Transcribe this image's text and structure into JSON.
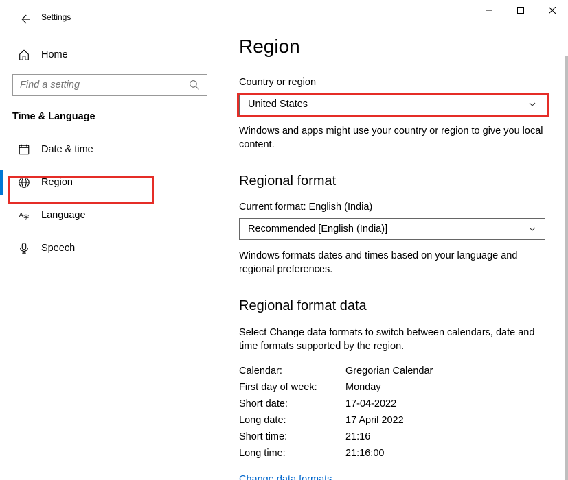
{
  "header": {
    "title": "Settings"
  },
  "sidebar": {
    "home_label": "Home",
    "search_placeholder": "Find a setting",
    "section_title": "Time & Language",
    "items": [
      {
        "label": "Date & time"
      },
      {
        "label": "Region"
      },
      {
        "label": "Language"
      },
      {
        "label": "Speech"
      }
    ]
  },
  "content": {
    "page_title": "Region",
    "country": {
      "label": "Country or region",
      "value": "United States",
      "help": "Windows and apps might use your country or region to give you local content."
    },
    "regional_format": {
      "title": "Regional format",
      "current_label": "Current format: English (India)",
      "value": "Recommended [English (India)]",
      "help": "Windows formats dates and times based on your language and regional preferences."
    },
    "format_data": {
      "title": "Regional format data",
      "help": "Select Change data formats to switch between calendars, date and time formats supported by the region.",
      "rows": [
        {
          "key": "Calendar:",
          "val": "Gregorian Calendar"
        },
        {
          "key": "First day of week:",
          "val": "Monday"
        },
        {
          "key": "Short date:",
          "val": "17-04-2022"
        },
        {
          "key": "Long date:",
          "val": "17 April 2022"
        },
        {
          "key": "Short time:",
          "val": "21:16"
        },
        {
          "key": "Long time:",
          "val": "21:16:00"
        }
      ],
      "link": "Change data formats"
    }
  }
}
